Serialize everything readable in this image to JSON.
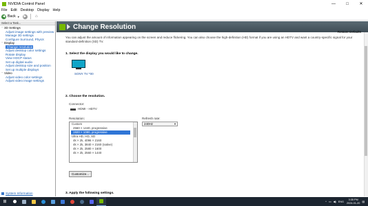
{
  "window": {
    "title": "NVIDIA Control Panel",
    "controls": {
      "minimize": "—",
      "maximize": "□",
      "close": "✕"
    }
  },
  "menu": [
    "File",
    "Edit",
    "Desktop",
    "Display",
    "Help"
  ],
  "toolbar": {
    "back_label": "Back"
  },
  "left": {
    "header": "Select a Task...",
    "tree": [
      {
        "type": "cat",
        "label": "3D Settings"
      },
      {
        "type": "task",
        "label": "Adjust image settings with preview"
      },
      {
        "type": "task",
        "label": "Manage 3D settings"
      },
      {
        "type": "task",
        "label": "Configure Surround, PhysX"
      },
      {
        "type": "cat",
        "label": "Display"
      },
      {
        "type": "task",
        "label": "Change resolution",
        "selected": true
      },
      {
        "type": "task",
        "label": "Adjust desktop color settings"
      },
      {
        "type": "task",
        "label": "Rotate display"
      },
      {
        "type": "task",
        "label": "View HDCP status"
      },
      {
        "type": "task",
        "label": "Set up digital audio"
      },
      {
        "type": "task",
        "label": "Adjust desktop size and position"
      },
      {
        "type": "task",
        "label": "Set up multiple displays"
      },
      {
        "type": "cat",
        "label": "Video"
      },
      {
        "type": "task",
        "label": "Adjust video color settings"
      },
      {
        "type": "task",
        "label": "Adjust video image settings"
      }
    ],
    "system_info": "System Information"
  },
  "page": {
    "title": "Change Resolution",
    "restore": "Restore Defaults",
    "intro": "You can adjust the amount of information appearing on the screen and reduce flickering. You can also choose the high-definition (HD) format if you are using an HDTV and want a country-specific signal for your standard-definition (SD) TV.",
    "section1": "1. Select the display you would like to change.",
    "display_label": "SONY TV  *00",
    "section2": "2. Choose the resolution.",
    "connector_label": "Connector:",
    "connector_value": "HDMI - HDTV",
    "resolution_label": "Resolution:",
    "refresh_label": "Refresh rate:",
    "refresh_value": "240Hz",
    "resolutions": [
      {
        "type": "group",
        "label": "Custom"
      },
      {
        "type": "item",
        "label": "2560 × 1440, progressive"
      },
      {
        "type": "item",
        "label": "1920 × 1080, progressive",
        "selected": true
      },
      {
        "type": "group",
        "label": "Ultra HD, HD, SD"
      },
      {
        "type": "item",
        "label": "4k × 2k, 4096 × 2160"
      },
      {
        "type": "item",
        "label": "4k × 2k, 3840 × 2160 (native)"
      },
      {
        "type": "item",
        "label": "4k × 2k, 2580 × 1600"
      },
      {
        "type": "item",
        "label": "4k × 2k, 2560 × 1440"
      }
    ],
    "customize": "Customize...",
    "section3": "3. Apply the following settings."
  },
  "taskbar": {
    "lang": "ENG",
    "time": "3:35 PM",
    "date": "2024-01-20"
  }
}
